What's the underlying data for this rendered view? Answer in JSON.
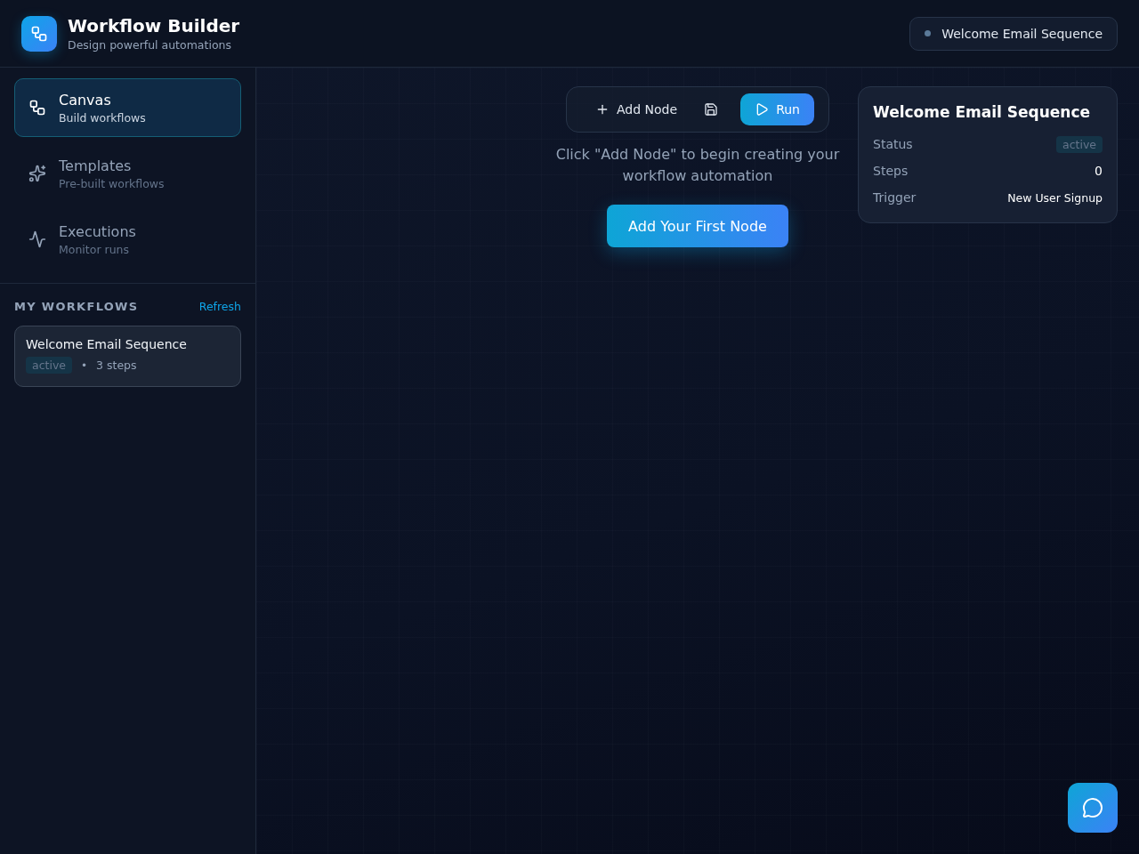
{
  "app": {
    "title": "Workflow Builder",
    "subtitle": "Design powerful automations"
  },
  "current_workflow": {
    "name": "Welcome Email Sequence"
  },
  "nav": [
    {
      "kind": "canvas",
      "label": "Canvas",
      "description": "Build workflows",
      "selected": true
    },
    {
      "kind": "templates",
      "label": "Templates",
      "description": "Pre-built workflows",
      "selected": false
    },
    {
      "kind": "executions",
      "label": "Executions",
      "description": "Monitor runs",
      "selected": false
    }
  ],
  "workflows_section": {
    "heading": "MY WORKFLOWS",
    "action": "Refresh",
    "items": [
      {
        "name": "Welcome Email Sequence",
        "status": "active",
        "separator": "•",
        "steps": "3 steps"
      }
    ]
  },
  "canvas": {
    "empty_text": "Click \"Add Node\" to begin creating your workflow automation",
    "first_node_button": "Add Your First Node"
  },
  "toolbar": {
    "add_node": "Add Node",
    "run": "Run"
  },
  "info_card": {
    "title": "Welcome Email Sequence",
    "rows": [
      {
        "kind": "badge",
        "label": "Status",
        "value": "active"
      },
      {
        "kind": "text",
        "label": "Steps",
        "value": "0"
      },
      {
        "kind": "text",
        "label": "Trigger",
        "value": "New User Signup"
      }
    ]
  }
}
